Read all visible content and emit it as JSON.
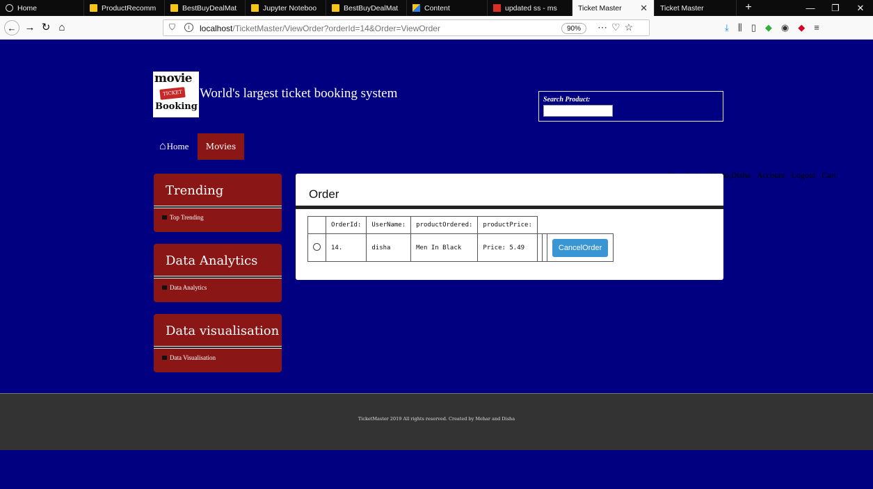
{
  "browser": {
    "tabs": [
      {
        "label": "Home",
        "icon": "firefox-home-icon"
      },
      {
        "label": "ProductRecomm",
        "icon": "notebook-icon"
      },
      {
        "label": "BestBuyDealMat",
        "icon": "notebook-icon"
      },
      {
        "label": "Jupyter Noteboo",
        "icon": "notebook-icon"
      },
      {
        "label": "BestBuyDealMat",
        "icon": "notebook-icon"
      },
      {
        "label": "Content",
        "icon": "pencil-icon"
      },
      {
        "label": "updated ss - ms",
        "icon": "gmail-icon"
      },
      {
        "label": "Ticket Master",
        "icon": "",
        "active": true
      },
      {
        "label": "Ticket Master",
        "icon": ""
      }
    ],
    "url_host": "localhost",
    "url_path": "/TicketMaster/ViewOrder?orderId=14&Order=ViewOrder",
    "zoom": "90%"
  },
  "site": {
    "logo": {
      "line1": "movie",
      "badge": "TICKET",
      "line3": "Booking"
    },
    "tagline": "World's largest ticket booking system",
    "search_label": "Search Product:",
    "nav": {
      "home": "Home",
      "movies": "Movies"
    },
    "top_links": [
      "ViewOrder",
      "Hello,Disha",
      "Account",
      "Logout",
      "Cart"
    ]
  },
  "sidebar": [
    {
      "heading": "Trending",
      "item": "Top Trending"
    },
    {
      "heading": "Data Analytics",
      "item": "Data Analytics"
    },
    {
      "heading": "Data visualisation",
      "item": "Data Visualisation"
    }
  ],
  "order": {
    "title": "Order",
    "headers": [
      "OrderId:",
      "UserName:",
      "productOrdered:",
      "productPrice:"
    ],
    "row": {
      "id": "14.",
      "user": "disha",
      "product": "Men In Black",
      "price": "Price: 5.49"
    },
    "cancel_label": "CancelOrder"
  },
  "footer": "TicketMaster 2019 All rights reserved. Created by Mehar and Disha",
  "colors": {
    "page_bg": "#000080",
    "accent_red": "#8b1616",
    "button_blue": "#3a95d3",
    "footer_bg": "#333333"
  }
}
